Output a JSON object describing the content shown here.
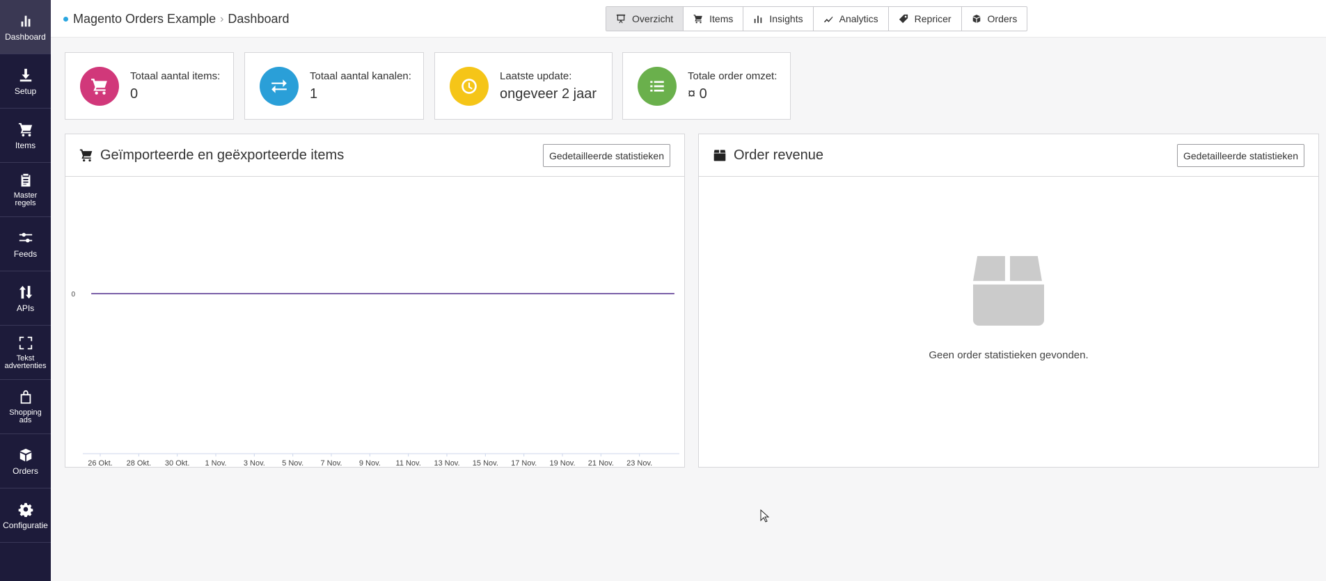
{
  "sidebar": {
    "items": [
      {
        "label": "Dashboard",
        "icon": "bar-chart-icon",
        "active": true
      },
      {
        "label": "Setup",
        "icon": "download-icon"
      },
      {
        "label": "Items",
        "icon": "cart-icon"
      },
      {
        "label": "Master regels",
        "icon": "clipboard-icon"
      },
      {
        "label": "Feeds",
        "icon": "sliders-icon"
      },
      {
        "label": "APIs",
        "icon": "arrows-updown-icon"
      },
      {
        "label": "Tekst advertenties",
        "icon": "expand-icon"
      },
      {
        "label": "Shopping ads",
        "icon": "shopping-bag-icon"
      },
      {
        "label": "Orders",
        "icon": "box-icon"
      },
      {
        "label": "Configuratie",
        "icon": "gear-icon"
      }
    ]
  },
  "breadcrumb": {
    "project": "Magento Orders Example",
    "page": "Dashboard"
  },
  "topnav": [
    {
      "label": "Overzicht",
      "icon": "presentation-icon",
      "active": true
    },
    {
      "label": "Items",
      "icon": "cart-icon"
    },
    {
      "label": "Insights",
      "icon": "bar-chart-icon"
    },
    {
      "label": "Analytics",
      "icon": "line-chart-icon"
    },
    {
      "label": "Repricer",
      "icon": "tag-icon"
    },
    {
      "label": "Orders",
      "icon": "box-icon"
    }
  ],
  "stats": [
    {
      "label": "Totaal aantal items:",
      "value": "0",
      "color": "#d1387a",
      "icon": "cart-icon"
    },
    {
      "label": "Totaal aantal kanalen:",
      "value": "1",
      "color": "#2a9fd8",
      "icon": "exchange-icon"
    },
    {
      "label": "Laatste update:",
      "value": "ongeveer 2 jaar",
      "color": "#f5c518",
      "icon": "clock-icon"
    },
    {
      "label": "Totale order omzet:",
      "value": "¤ 0",
      "color": "#6ab04c",
      "icon": "list-icon"
    }
  ],
  "items_panel": {
    "title": "Geïmporteerde en geëxporteerde items",
    "button": "Gedetailleerde statistieken"
  },
  "revenue_panel": {
    "title": "Order revenue",
    "button": "Gedetailleerde statistieken",
    "empty_message": "Geen order statistieken gevonden."
  },
  "chart_data": {
    "type": "line",
    "categories": [
      "26 Okt.",
      "28 Okt.",
      "30 Okt.",
      "1 Nov.",
      "3 Nov.",
      "5 Nov.",
      "7 Nov.",
      "9 Nov.",
      "11 Nov.",
      "13 Nov.",
      "15 Nov.",
      "17 Nov.",
      "19 Nov.",
      "21 Nov.",
      "23 Nov."
    ],
    "y_ticks": [
      "0"
    ],
    "series": [
      {
        "color": "#c0408a",
        "values": [
          0,
          0,
          0,
          0,
          0,
          0,
          0,
          0,
          0,
          0,
          0,
          0,
          0,
          0,
          0
        ]
      },
      {
        "color": "#7a5fa8",
        "values": [
          0,
          0,
          0,
          0,
          0,
          0,
          0,
          0,
          0,
          0,
          0,
          0,
          0,
          0,
          0
        ]
      }
    ],
    "grid": false
  }
}
